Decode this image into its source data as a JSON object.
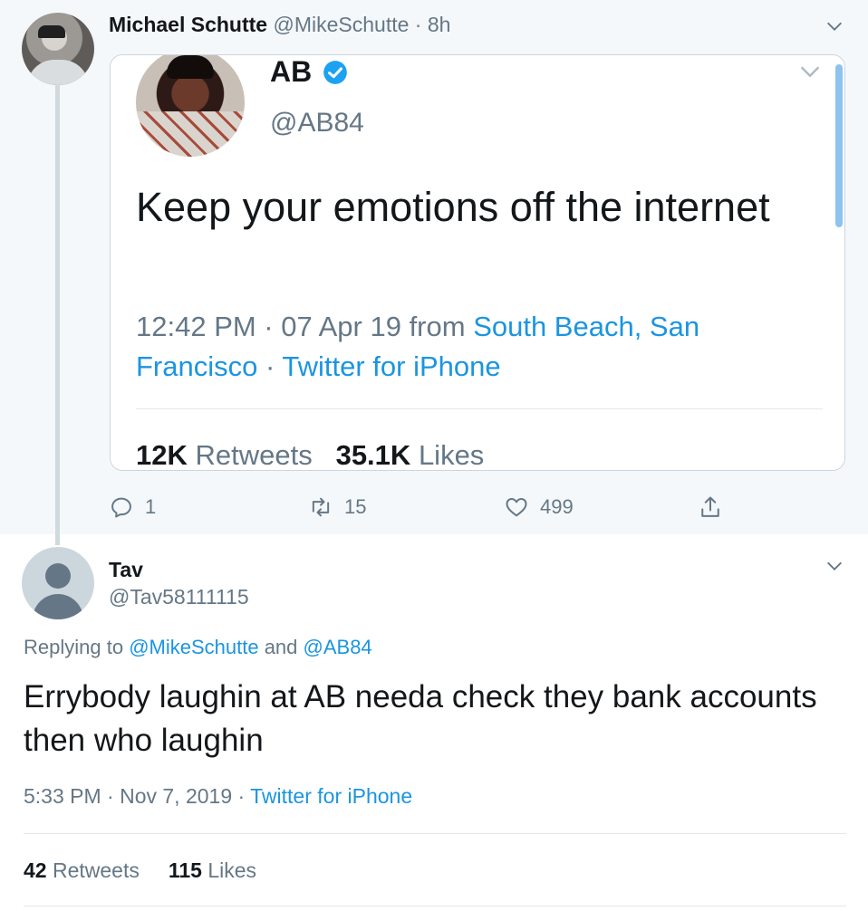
{
  "colors": {
    "link": "#1b95e0",
    "muted": "#657786",
    "text": "#14171a",
    "thread_bg": "#f5f8fa",
    "verified": "#1da1f2"
  },
  "top_tweet": {
    "name": "Michael Schutte",
    "handle": "@MikeSchutte",
    "separator": " · ",
    "time": "8h",
    "icons": {
      "menu": "chevron-down-icon"
    },
    "quote": {
      "name": "AB",
      "handle": "@AB84",
      "text": "Keep your emotions off the internet",
      "time": "12:42 PM · 07 Apr 19 from ",
      "location": "South Beach, San Francisco",
      "dot": " · ",
      "source": "Twitter for iPhone",
      "retweets_count": "12K",
      "retweets_label": "Retweets",
      "likes_count": "35.1K",
      "likes_label": "Likes",
      "icons": {
        "verified": "verified-badge-icon",
        "menu": "chevron-down-icon"
      }
    },
    "actions": {
      "reply_count": "1",
      "retweet_count": "15",
      "like_count": "499",
      "icons": {
        "reply": "reply-icon",
        "retweet": "retweet-icon",
        "like": "heart-icon",
        "share": "share-icon"
      }
    }
  },
  "reply_tweet": {
    "name": "Tav",
    "handle": "@Tav58111115",
    "replying_prefix": "Replying to ",
    "replying_user1": "@MikeSchutte",
    "replying_and": " and ",
    "replying_user2": "@AB84",
    "text": "Errybody laughin at AB needa check they bank accounts then who laughin",
    "time": "5:33 PM · Nov 7, 2019",
    "dot": " · ",
    "source": "Twitter for iPhone",
    "retweets_count": "42",
    "retweets_label": "Retweets",
    "likes_count": "115",
    "likes_label": "Likes",
    "icons": {
      "menu": "chevron-down-icon"
    }
  }
}
